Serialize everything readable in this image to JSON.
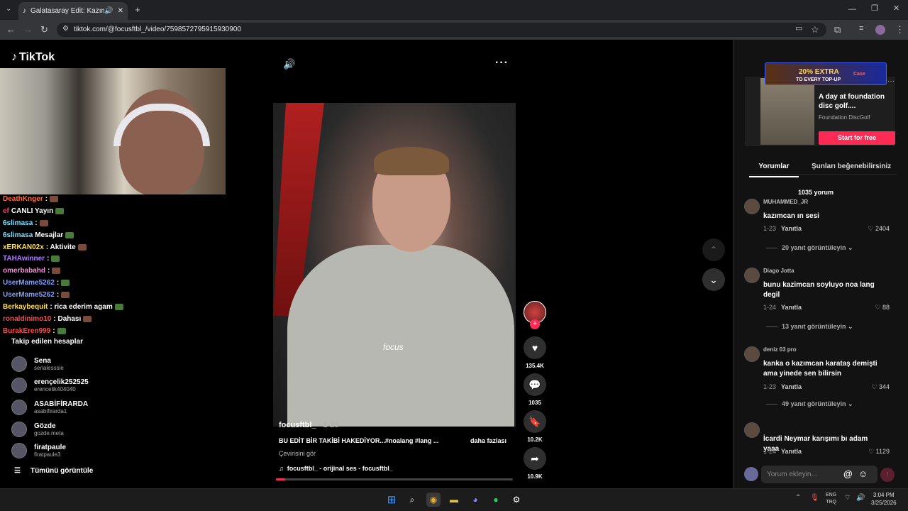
{
  "browser": {
    "tab_title": "Galatasaray Edit: Kazımcan",
    "url": "tiktok.com/@focusftbl_/video/7598572795915930900"
  },
  "app": {
    "logo_text": "TikTok"
  },
  "stream_chat": [
    {
      "user": "DeathKnger",
      "msg": ":",
      "color": "#ff6a3a"
    },
    {
      "user": "ef",
      "msg": "CANLI Yayın",
      "color": "#ff3a6a"
    },
    {
      "user": "6slimasa",
      "msg": ":",
      "color": "#7ae0ff"
    },
    {
      "user": "6slimasa",
      "msg": "Mesajlar",
      "color": "#7ae0ff"
    },
    {
      "user": "xERKAN02x",
      "msg": ": Aktivite",
      "color": "#ffe04a"
    },
    {
      "user": "TAHAwinner",
      "msg": ":",
      "color": "#b080ff"
    },
    {
      "user": "omerbabahd",
      "msg": ":",
      "color": "#ff8ae0"
    },
    {
      "user": "UserMame5262",
      "msg": ":",
      "color": "#80a0ff"
    },
    {
      "user": "UserMame5262",
      "msg": ":",
      "color": "#80a0ff"
    },
    {
      "user": "Berkaybequit",
      "msg": ": rica ederim agam",
      "color": "#ffe04a"
    },
    {
      "user": "ronaldinimo10",
      "msg": ": Dahası",
      "color": "#ff4a4a"
    },
    {
      "user": "BurakEren999",
      "msg": ":",
      "color": "#ff4a4a"
    }
  ],
  "following": {
    "title": "Takip edilen hesaplar",
    "accounts": [
      {
        "name": "Sena",
        "handle": "senalesssie"
      },
      {
        "name": "erençelik252525",
        "handle": "erencelik404040"
      },
      {
        "name": "ASABİFİRARDA",
        "handle": "asabifirarda1"
      },
      {
        "name": "Gözde",
        "handle": "gozde.meta"
      },
      {
        "name": "firatpaule",
        "handle": "firatpaule3"
      }
    ],
    "see_all": "Tümünü görüntüle"
  },
  "video": {
    "author": "focusftbl_",
    "date": "· 1-23",
    "description": "BU EDİT BİR TAKİBİ HAKEDİYOR...#noalang #lang ...",
    "more": "daha fazlası",
    "translation": "Çevirisini gör",
    "music": "focusftbl_ - orijinal ses - focusftbl_",
    "overlay_text": "focus",
    "progress": 0.04
  },
  "actions": {
    "likes": "135.4K",
    "comments": "1035",
    "saves": "10.2K",
    "shares": "10.9K"
  },
  "ad": {
    "banner_top": "20% EXTRA",
    "banner_sub": "TO EVERY TOP-UP",
    "banner_brand": "Case",
    "title": "A day at foundation disc golf....",
    "subtitle": "Foundation DiscGolf",
    "cta": "Start for free"
  },
  "comments_panel": {
    "tab_comments": "Yorumlar",
    "tab_like": "Şunları beğenebilirsiniz",
    "count": "1035 yorum",
    "reply_label": "Yanıtla",
    "items": [
      {
        "user": "MUHAMMED_JR",
        "text": "kazımcan ın sesi",
        "date": "1-23",
        "likes": "2404",
        "replies": "20 yanıt görüntüleyin"
      },
      {
        "user": "Diago Jotta",
        "text": "bunu kazimcan soyluyo noa lang degil",
        "date": "1-24",
        "likes": "88",
        "replies": "13 yanıt görüntüleyin"
      },
      {
        "user": "deniz 03 pro",
        "text": "kanka o kazımcan karataş demişti ama yinede sen bilirsin",
        "date": "1-23",
        "likes": "344",
        "replies": "49 yanıt görüntüleyin"
      },
      {
        "user": "",
        "text": "İcardi Neymar karışımı bı adam yaaa",
        "date": "1-24",
        "likes": "1129",
        "replies": ""
      }
    ],
    "add_placeholder": "Yorum ekleyin..."
  },
  "taskbar": {
    "lang_top": "ENG",
    "lang_bottom": "TRQ",
    "time": "3:04 PM",
    "date": "3/25/2026"
  }
}
